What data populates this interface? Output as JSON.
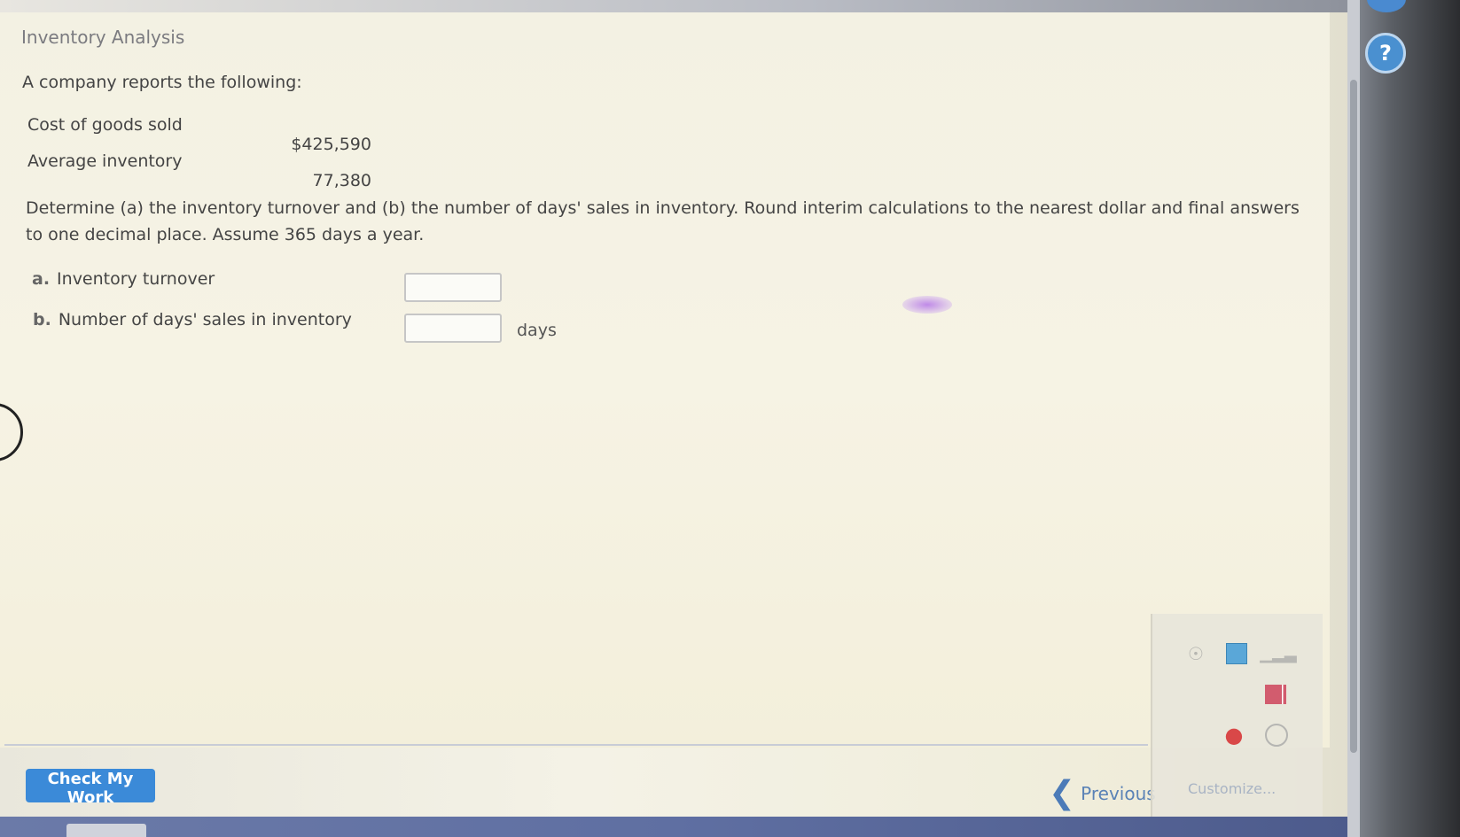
{
  "page": {
    "title": "Inventory Analysis",
    "intro": "A company reports the following:"
  },
  "given": [
    {
      "label": "Cost of goods sold",
      "value": "$425,590"
    },
    {
      "label": "Average inventory",
      "value": "77,380"
    }
  ],
  "instructions": "Determine (a) the inventory turnover and (b) the number of days' sales in inventory. Round interim calculations to the nearest dollar and final answers to one decimal place. Assume 365 days a year.",
  "questions": [
    {
      "letter": "a.",
      "label": "Inventory turnover",
      "value": "",
      "unit": ""
    },
    {
      "letter": "b.",
      "label": "Number of days' sales in inventory",
      "value": "",
      "unit": "days"
    }
  ],
  "footer": {
    "check_label": "Check My Work",
    "previous_label": "Previous",
    "customize_label": "Customize..."
  },
  "tools": {
    "audio_icon": "speaker-icon",
    "calculator_icon": "calculator-icon",
    "chart_icon": "signal-bars-icon",
    "flag_icon": "flag-icon",
    "red_icon": "alert-icon",
    "ebook_icon": "ebook-icon"
  },
  "help": {
    "icon": "?"
  },
  "colors": {
    "accent": "#3b8ad8",
    "link": "#5a82b6",
    "text": "#444444",
    "title": "#7b7b80"
  }
}
